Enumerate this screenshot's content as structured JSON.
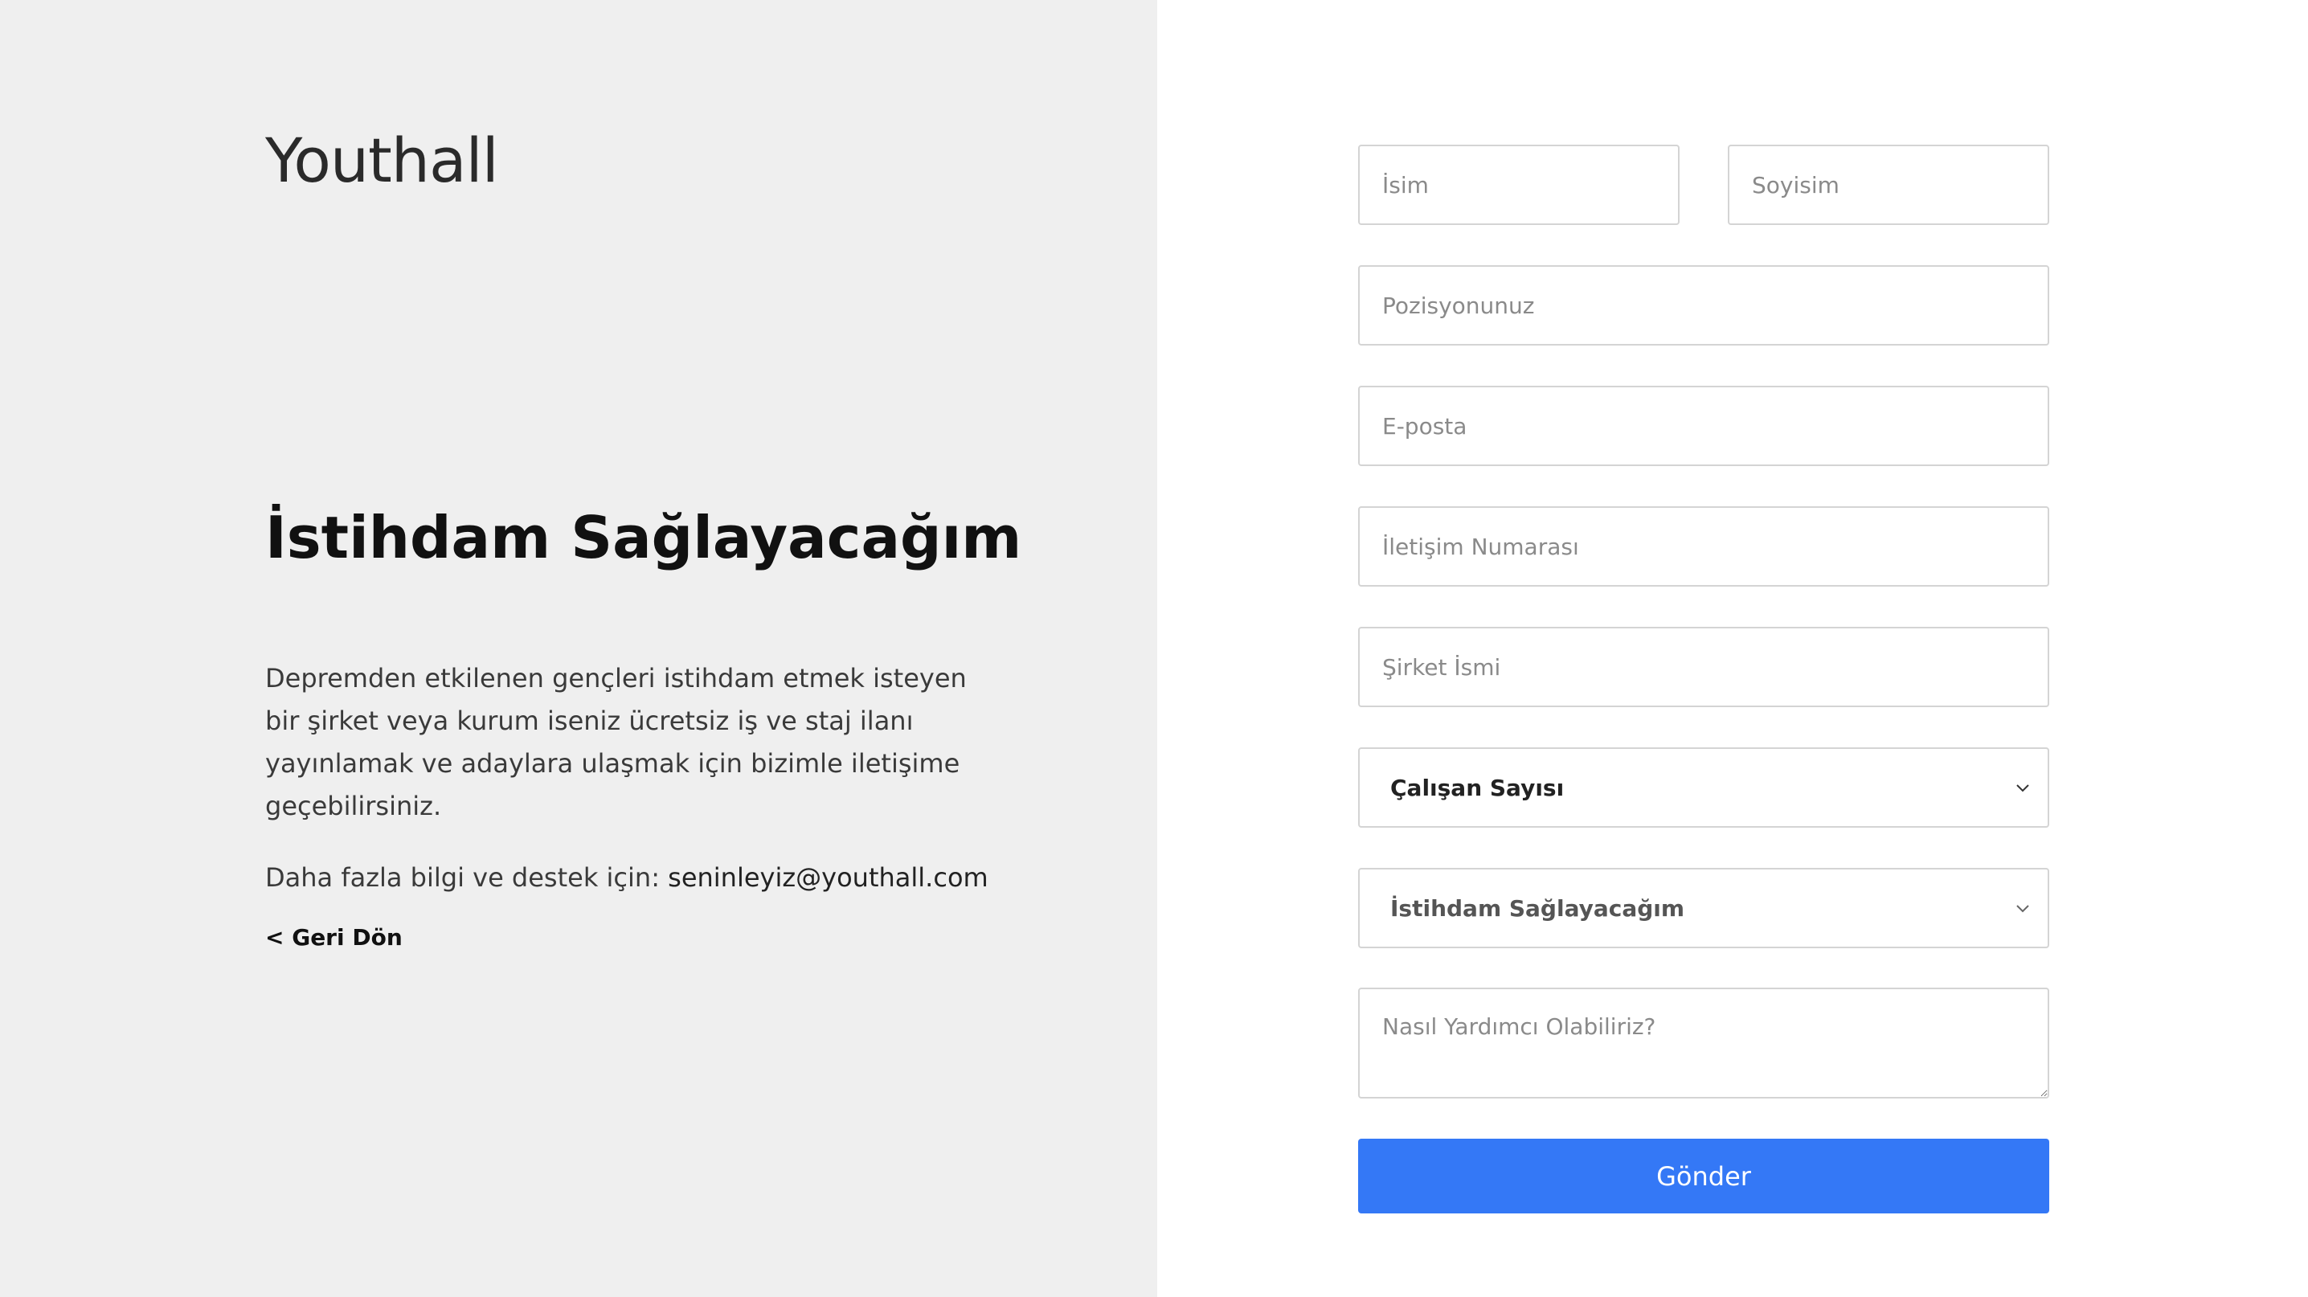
{
  "brand": {
    "logo_text": "Youthall"
  },
  "info": {
    "title": "İstihdam Sağlayacağım",
    "description": "Depremden etkilenen gençleri istihdam etmek isteyen bir şirket veya kurum iseniz ücretsiz iş ve staj ilanı yayınlamak ve adaylara ulaşmak için bizimle iletişime geçebilirsiniz.",
    "contact_prefix": "Daha fazla bilgi ve destek için: ",
    "contact_email": "seninleyiz@youthall.com",
    "back_link": "< Geri Dön"
  },
  "form": {
    "first_name": {
      "placeholder": "İsim",
      "value": ""
    },
    "last_name": {
      "placeholder": "Soyisim",
      "value": ""
    },
    "position": {
      "placeholder": "Pozisyonunuz",
      "value": ""
    },
    "email": {
      "placeholder": "E-posta",
      "value": ""
    },
    "phone": {
      "placeholder": "İletişim Numarası",
      "value": ""
    },
    "company": {
      "placeholder": "Şirket İsmi",
      "value": ""
    },
    "employee_count": {
      "selected": "Çalışan Sayısı"
    },
    "intent": {
      "selected": "İstihdam Sağlayacağım"
    },
    "message": {
      "placeholder": "Nasıl Yardımcı Olabiliriz?",
      "value": ""
    },
    "submit_label": "Gönder"
  },
  "colors": {
    "left_panel_bg": "#efefef",
    "accent": "#3478f6"
  },
  "icons": {
    "select_arrow": "chevron-down-icon",
    "textarea_resize": "resize-grip-icon"
  }
}
